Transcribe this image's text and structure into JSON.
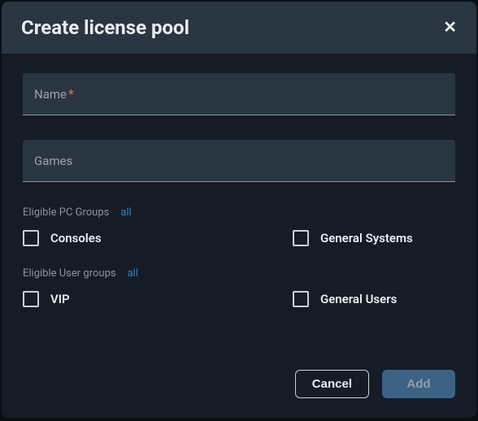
{
  "modal": {
    "title": "Create license pool"
  },
  "fields": {
    "name_label": "Name",
    "games_label": "Games"
  },
  "pc_groups": {
    "title": "Eligible PC Groups",
    "all": "all",
    "items": [
      "Consoles",
      "General Systems"
    ]
  },
  "user_groups": {
    "title": "Eligible User groups",
    "all": "all",
    "items": [
      "VIP",
      "General Users"
    ]
  },
  "footer": {
    "cancel": "Cancel",
    "add": "Add"
  }
}
